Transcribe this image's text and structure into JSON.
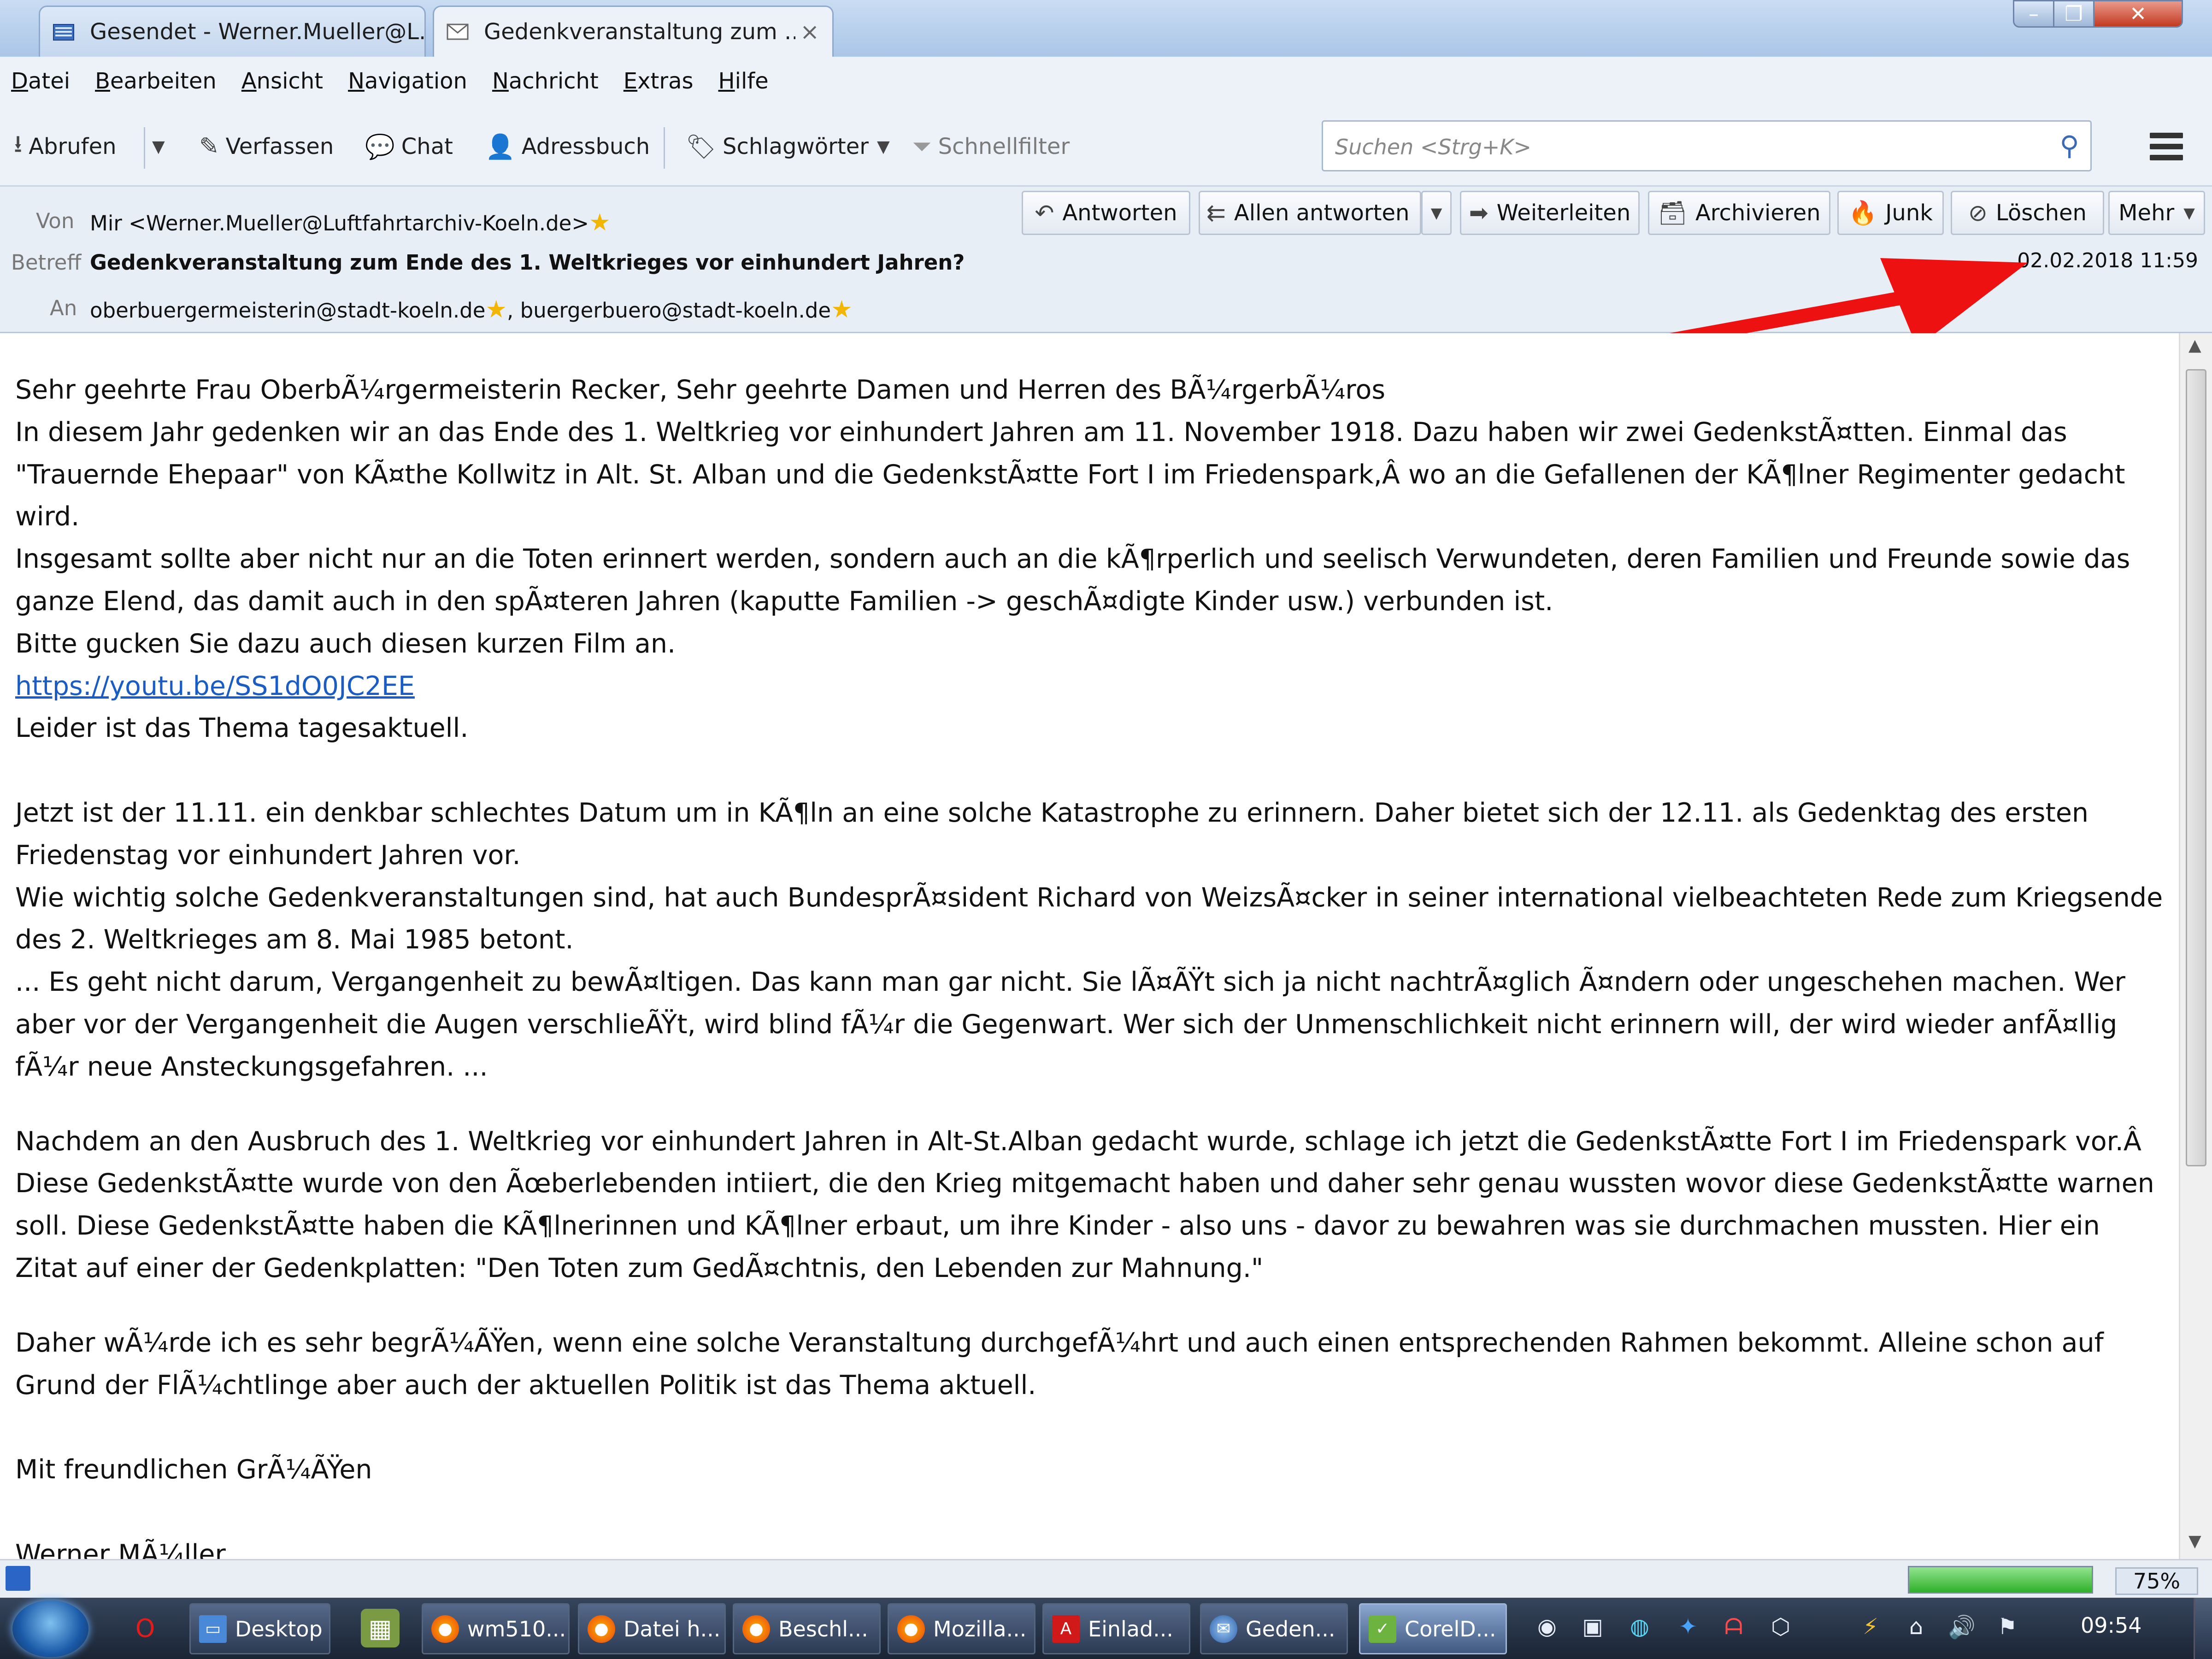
{
  "tabs": [
    {
      "label": "Gesendet - Werner.Mueller@L...",
      "icon": "folder-icon"
    },
    {
      "label": "Gedenkveranstaltung zum ...",
      "icon": "envelope-icon",
      "close": "×"
    }
  ],
  "window_controls": {
    "minimize": "–",
    "maximize": "❐",
    "close": "✕"
  },
  "menu": [
    "Datei",
    "Bearbeiten",
    "Ansicht",
    "Navigation",
    "Nachricht",
    "Extras",
    "Hilfe"
  ],
  "toolbar": {
    "get_mail": "Abrufen",
    "compose": "Verfassen",
    "chat": "Chat",
    "address_book": "Adressbuch",
    "tags": "Schlagwörter",
    "quick_filter": "Schnellfilter",
    "search_placeholder": "Suchen <Strg+K>"
  },
  "header": {
    "from_label": "Von",
    "from_value": "Mir <Werner.Mueller@Luftfahrtarchiv-Koeln.de>",
    "subject_label": "Betreff",
    "subject_value": "Gedenkveranstaltung zum Ende des 1. Weltkrieges vor einhundert Jahren?",
    "to_label": "An",
    "to_value_1": "oberbuergermeisterin@stadt-koeln.de",
    "to_value_2": ", buergerbuero@stadt-koeln.de",
    "date": "02.02.2018 11:59"
  },
  "actions": {
    "reply": "Antworten",
    "reply_all": "Allen antworten",
    "forward": "Weiterleiten",
    "archive": "Archivieren",
    "junk": "Junk",
    "delete": "Löschen",
    "more": "Mehr"
  },
  "body": {
    "p1": "Sehr geehrte Frau OberbÃ¼rgermeisterin Recker, Sehr geehrte Damen und Herren des BÃ¼rgerbÃ¼ros",
    "p2": "In diesem Jahr gedenken wir an das Ende des 1. Weltkrieg vor einhundert Jahren am 11. November 1918. Dazu haben wir zwei GedenkstÃ¤tten. Einmal das \"Trauernde Ehepaar\" von KÃ¤the Kollwitz in Alt. St. Alban und die GedenkstÃ¤tte Fort I im Friedenspark,Â  wo an die Gefallenen der KÃ¶lner Regimenter gedacht wird.",
    "p3": "Insgesamt sollte aber nicht nur an die Toten erinnert werden, sondern auch an die kÃ¶rperlich und seelisch Verwundeten, deren Familien und Freunde sowie das ganze Elend, das damit auch in den spÃ¤teren Jahren (kaputte Familien -> geschÃ¤digte Kinder usw.) verbunden ist.",
    "p4": "Bitte gucken Sie dazu auch diesen kurzen Film an.",
    "link": "https://youtu.be/SS1dO0JC2EE",
    "p5": "Leider ist das Thema tagesaktuell.",
    "p6": "Jetzt ist der 11.11. ein denkbar schlechtes Datum um in KÃ¶ln an eine solche Katastrophe zu erinnern. Daher bietet sich der 12.11. als Gedenktag des ersten Friedenstag vor einhundert Jahren vor.",
    "p7": "Wie wichtig solche Gedenkveranstaltungen sind, hat auch BundesprÃ¤sident Richard von WeizsÃ¤cker in seiner international vielbeachteten Rede zum Kriegsende des 2. Weltkrieges am 8. Mai 1985 betont.",
    "p8": "... Es geht nicht darum, Vergangenheit zu bewÃ¤ltigen. Das kann man gar nicht. Sie lÃ¤ÃŸt sich ja nicht nachtrÃ¤glich Ã¤ndern oder ungeschehen machen. Wer aber vor der Vergangenheit die Augen verschlieÃŸt, wird blind fÃ¼r die Gegenwart. Wer sich der Unmenschlichkeit nicht erinnern will, der wird wieder anfÃ¤llig fÃ¼r neue Ansteckungsgefahren. ...",
    "p9": "Nachdem an den Ausbruch des 1. Weltkrieg vor einhundert Jahren in Alt-St.Alban gedacht wurde, schlage ich jetzt die GedenkstÃ¤tte Fort I im Friedenspark vor.Â  Diese GedenkstÃ¤tte wurde von den Ãœberlebenden intiiert, die den Krieg mitgemacht haben und daher sehr genau wussten wovor diese GedenkstÃ¤tte warnen soll. Diese GedenkstÃ¤tte haben die KÃ¶lnerinnen und KÃ¶lner erbaut, um ihre Kinder - also uns - davor zu bewahren was sie durchmachen mussten. Hier ein Zitat auf einer der Gedenkplatten: \"Den Toten zum GedÃ¤chtnis, den Lebenden zur Mahnung.\"",
    "p10": "Daher wÃ¼rde ich es sehr begrÃ¼ÃŸen, wenn eine solche Veranstaltung durchgefÃ¼hrt und auch einen entsprechenden Rahmen bekommt. Alleine schon auf Grund der FlÃ¼chtlinge aber auch der aktuellen Politik ist das Thema aktuell.",
    "p11": "Mit freundlichen GrÃ¼ÃŸen",
    "p12": "Werner MÃ¼ller"
  },
  "status": {
    "zoom": "75%",
    "progress": 1.0
  },
  "taskbar": {
    "items": [
      "Desktop",
      "wm510...",
      "Datei h...",
      "Beschl...",
      "Mozilla...",
      "Einlad...",
      "Geden...",
      "CorelD..."
    ],
    "clock": "09:54"
  },
  "colors": {
    "accent_link": "#1a5bc4",
    "arrow": "#ee1111",
    "star": "#f2b600"
  }
}
